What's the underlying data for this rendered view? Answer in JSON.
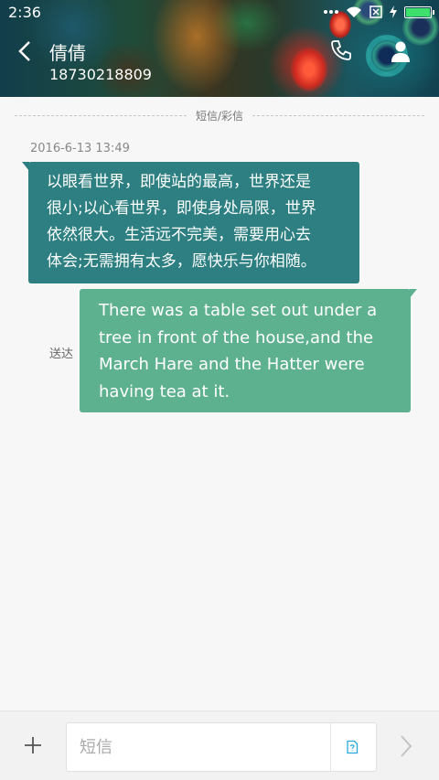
{
  "status_bar": {
    "time": "2:36",
    "icons": [
      "notification-dots-icon",
      "wifi-icon",
      "sim-disabled-icon",
      "charging-icon",
      "battery-icon"
    ]
  },
  "header": {
    "contact_name": "倩倩",
    "contact_number": "18730218809",
    "icons": [
      "back-icon",
      "phone-icon",
      "person-icon"
    ]
  },
  "conversation": {
    "type_divider": "短信/彩信",
    "timestamp": "2016-6-13 13:49",
    "messages": [
      {
        "direction": "incoming",
        "lines": [
          "以眼看世界，即使站的最高，世界还是",
          "很小;以心看世界，即使身处局限，世界",
          "依然很大。生活远不完美，需要用心去",
          "体会;无需拥有太多，愿快乐与你相随。"
        ]
      },
      {
        "direction": "outgoing",
        "status": "送达",
        "lines": [
          "There was a table set out under a",
          "tree in front of the house,and the",
          "March Hare and the Hatter were",
          "having tea at it."
        ]
      }
    ]
  },
  "composer": {
    "placeholder": "短信",
    "value": "",
    "icons": [
      "add-icon",
      "sim-card-icon",
      "send-icon"
    ]
  },
  "colors": {
    "incoming_bubble": "#2d7f82",
    "outgoing_bubble": "#5db18e",
    "background": "#f7f7f7",
    "battery_fill": "#3de06a"
  }
}
